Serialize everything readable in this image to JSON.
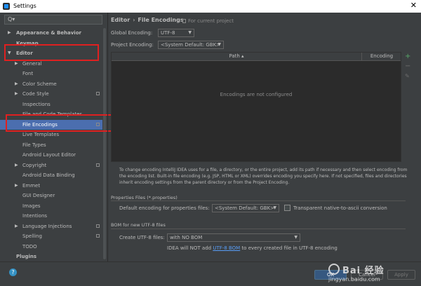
{
  "window": {
    "title": "Settings",
    "close_glyph": "✕"
  },
  "search": {
    "icon": "search-icon",
    "glyph": "Q▾"
  },
  "sidebar": {
    "items": [
      {
        "label": "Appearance & Behavior",
        "bold": true,
        "arrow": "▶"
      },
      {
        "label": "Keymap",
        "bold": true,
        "arrow": ""
      },
      {
        "label": "Editor",
        "bold": true,
        "arrow": "▼"
      },
      {
        "label": "General",
        "arrow": "▶"
      },
      {
        "label": "Font",
        "arrow": ""
      },
      {
        "label": "Color Scheme",
        "arrow": "▶"
      },
      {
        "label": "Code Style",
        "arrow": "▶"
      },
      {
        "label": "Inspections",
        "arrow": ""
      },
      {
        "label": "File and Code Templates",
        "arrow": ""
      },
      {
        "label": "File Encodings",
        "arrow": "",
        "selected": true
      },
      {
        "label": "Live Templates",
        "arrow": ""
      },
      {
        "label": "File Types",
        "arrow": ""
      },
      {
        "label": "Android Layout Editor",
        "arrow": ""
      },
      {
        "label": "Copyright",
        "arrow": "▶"
      },
      {
        "label": "Android Data Binding",
        "arrow": ""
      },
      {
        "label": "Emmet",
        "arrow": "▶"
      },
      {
        "label": "GUI Designer",
        "arrow": ""
      },
      {
        "label": "Images",
        "arrow": ""
      },
      {
        "label": "Intentions",
        "arrow": ""
      },
      {
        "label": "Language Injections",
        "arrow": "▶"
      },
      {
        "label": "Spelling",
        "arrow": ""
      },
      {
        "label": "TODO",
        "arrow": ""
      },
      {
        "label": "Plugins",
        "bold": true,
        "arrow": ""
      }
    ]
  },
  "breadcrumb": {
    "parent": "Editor",
    "sep": "›",
    "current": "File Encodings",
    "note": "For current project"
  },
  "global_encoding": {
    "label": "Global Encoding:",
    "value": "UTF-8"
  },
  "project_encoding": {
    "label": "Project Encoding:",
    "value": "<System Default: GBK>"
  },
  "table": {
    "col_path": "Path ▴",
    "col_encoding": "Encoding",
    "empty_text": "Encodings are not configured",
    "add": "+",
    "remove": "−",
    "edit": "✎"
  },
  "description": "To change encoding IntelliJ IDEA uses for a file, a directory, or the entire project, add its path if necessary and then select encoding from the encoding list. Built-in file encoding (e.g. JSP, HTML or XML) overrides encoding you specify here. If not specified, files and directories inherit encoding settings from the parent directory or from the Project Encoding.",
  "properties": {
    "section": "Properties Files (*.properties)",
    "default_label": "Default encoding for properties files:",
    "default_value": "<System Default: GBK>",
    "native_label": "Transparent native-to-ascii conversion",
    "native_checked": false
  },
  "bom": {
    "section": "BOM for new UTF-8 files",
    "create_label": "Create UTF-8 files:",
    "create_value": "with NO BOM",
    "note_pre": "IDEA will NOT add",
    "note_link": "UTF-8 BOM",
    "note_post": "to every created file in UTF-8 encoding"
  },
  "buttons": {
    "ok": "OK",
    "cancel": "Cancel",
    "apply": "Apply",
    "help": "?"
  },
  "watermark": {
    "brand": "Bai 经验",
    "url": "jingyan.baidu.com"
  },
  "colors": {
    "background": "#3c3f41",
    "selection": "#4b6eaf",
    "annotation": "#e02020",
    "link": "#589df6"
  }
}
